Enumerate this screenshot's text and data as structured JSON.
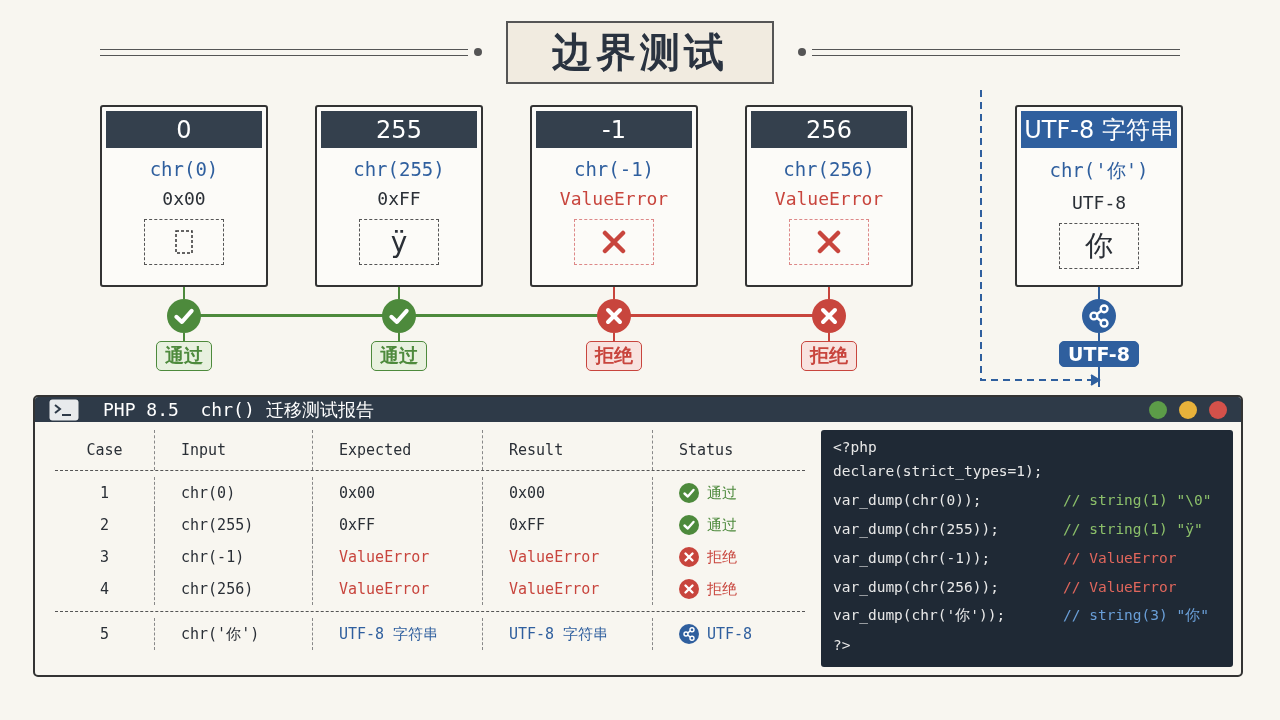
{
  "title": "边界测试",
  "tests": [
    {
      "header": "0",
      "call": "chr(0)",
      "result": "0x00",
      "glyph": {
        "kind": "empty"
      },
      "kind": "pass",
      "status": "通过"
    },
    {
      "header": "255",
      "call": "chr(255)",
      "result": "0xFF",
      "glyph": {
        "kind": "char",
        "text": "ÿ"
      },
      "kind": "pass",
      "status": "通过"
    },
    {
      "header": "-1",
      "call": "chr(-1)",
      "result": "ValueError",
      "glyph": {
        "kind": "error"
      },
      "kind": "reject",
      "status": "拒绝"
    },
    {
      "header": "256",
      "call": "chr(256)",
      "result": "ValueError",
      "glyph": {
        "kind": "error"
      },
      "kind": "reject",
      "status": "拒绝"
    }
  ],
  "utf8_card": {
    "header": "UTF-8 字符串",
    "call": "chr('你')",
    "result": "UTF-8",
    "glyph": {
      "kind": "char",
      "text": "你"
    },
    "kind": "utf8",
    "status": "UTF-8"
  },
  "terminal": {
    "title": "PHP 8.5  chr() 迁移测试报告",
    "columns": [
      "Case",
      "Input",
      "Expected",
      "Result",
      "Status"
    ],
    "rows": [
      {
        "kind": "pass",
        "cells": [
          "1",
          "chr(0)",
          "0x00",
          "0x00"
        ],
        "status": "通过"
      },
      {
        "kind": "pass",
        "cells": [
          "2",
          "chr(255)",
          "0xFF",
          "0xFF"
        ],
        "status": "通过"
      },
      {
        "kind": "reject",
        "cells": [
          "3",
          "chr(-1)",
          "ValueError",
          "ValueError"
        ],
        "status": "拒绝"
      },
      {
        "kind": "reject",
        "cells": [
          "4",
          "chr(256)",
          "ValueError",
          "ValueError"
        ],
        "status": "拒绝"
      },
      {
        "kind": "utf8",
        "cells": [
          "5",
          "chr('你')",
          "UTF-8 字符串",
          "UTF-8 字符串"
        ],
        "status": "UTF-8"
      }
    ],
    "code": [
      {
        "code": "<?php"
      },
      {
        "code": "declare(strict_types=1);"
      },
      {
        "kind": "pass",
        "code": "var_dump(chr(0));",
        "comment": "// string(1) \"\\0\""
      },
      {
        "kind": "pass",
        "code": "var_dump(chr(255));",
        "comment": "// string(1) \"ÿ\""
      },
      {
        "kind": "reject",
        "code": "var_dump(chr(-1));",
        "comment": "// ValueError"
      },
      {
        "kind": "reject",
        "code": "var_dump(chr(256));",
        "comment": "// ValueError"
      },
      {
        "kind": "utf8",
        "code": "var_dump(chr('你'));",
        "comment": "// string(3) \"你\""
      },
      {
        "code": "?>"
      }
    ]
  }
}
